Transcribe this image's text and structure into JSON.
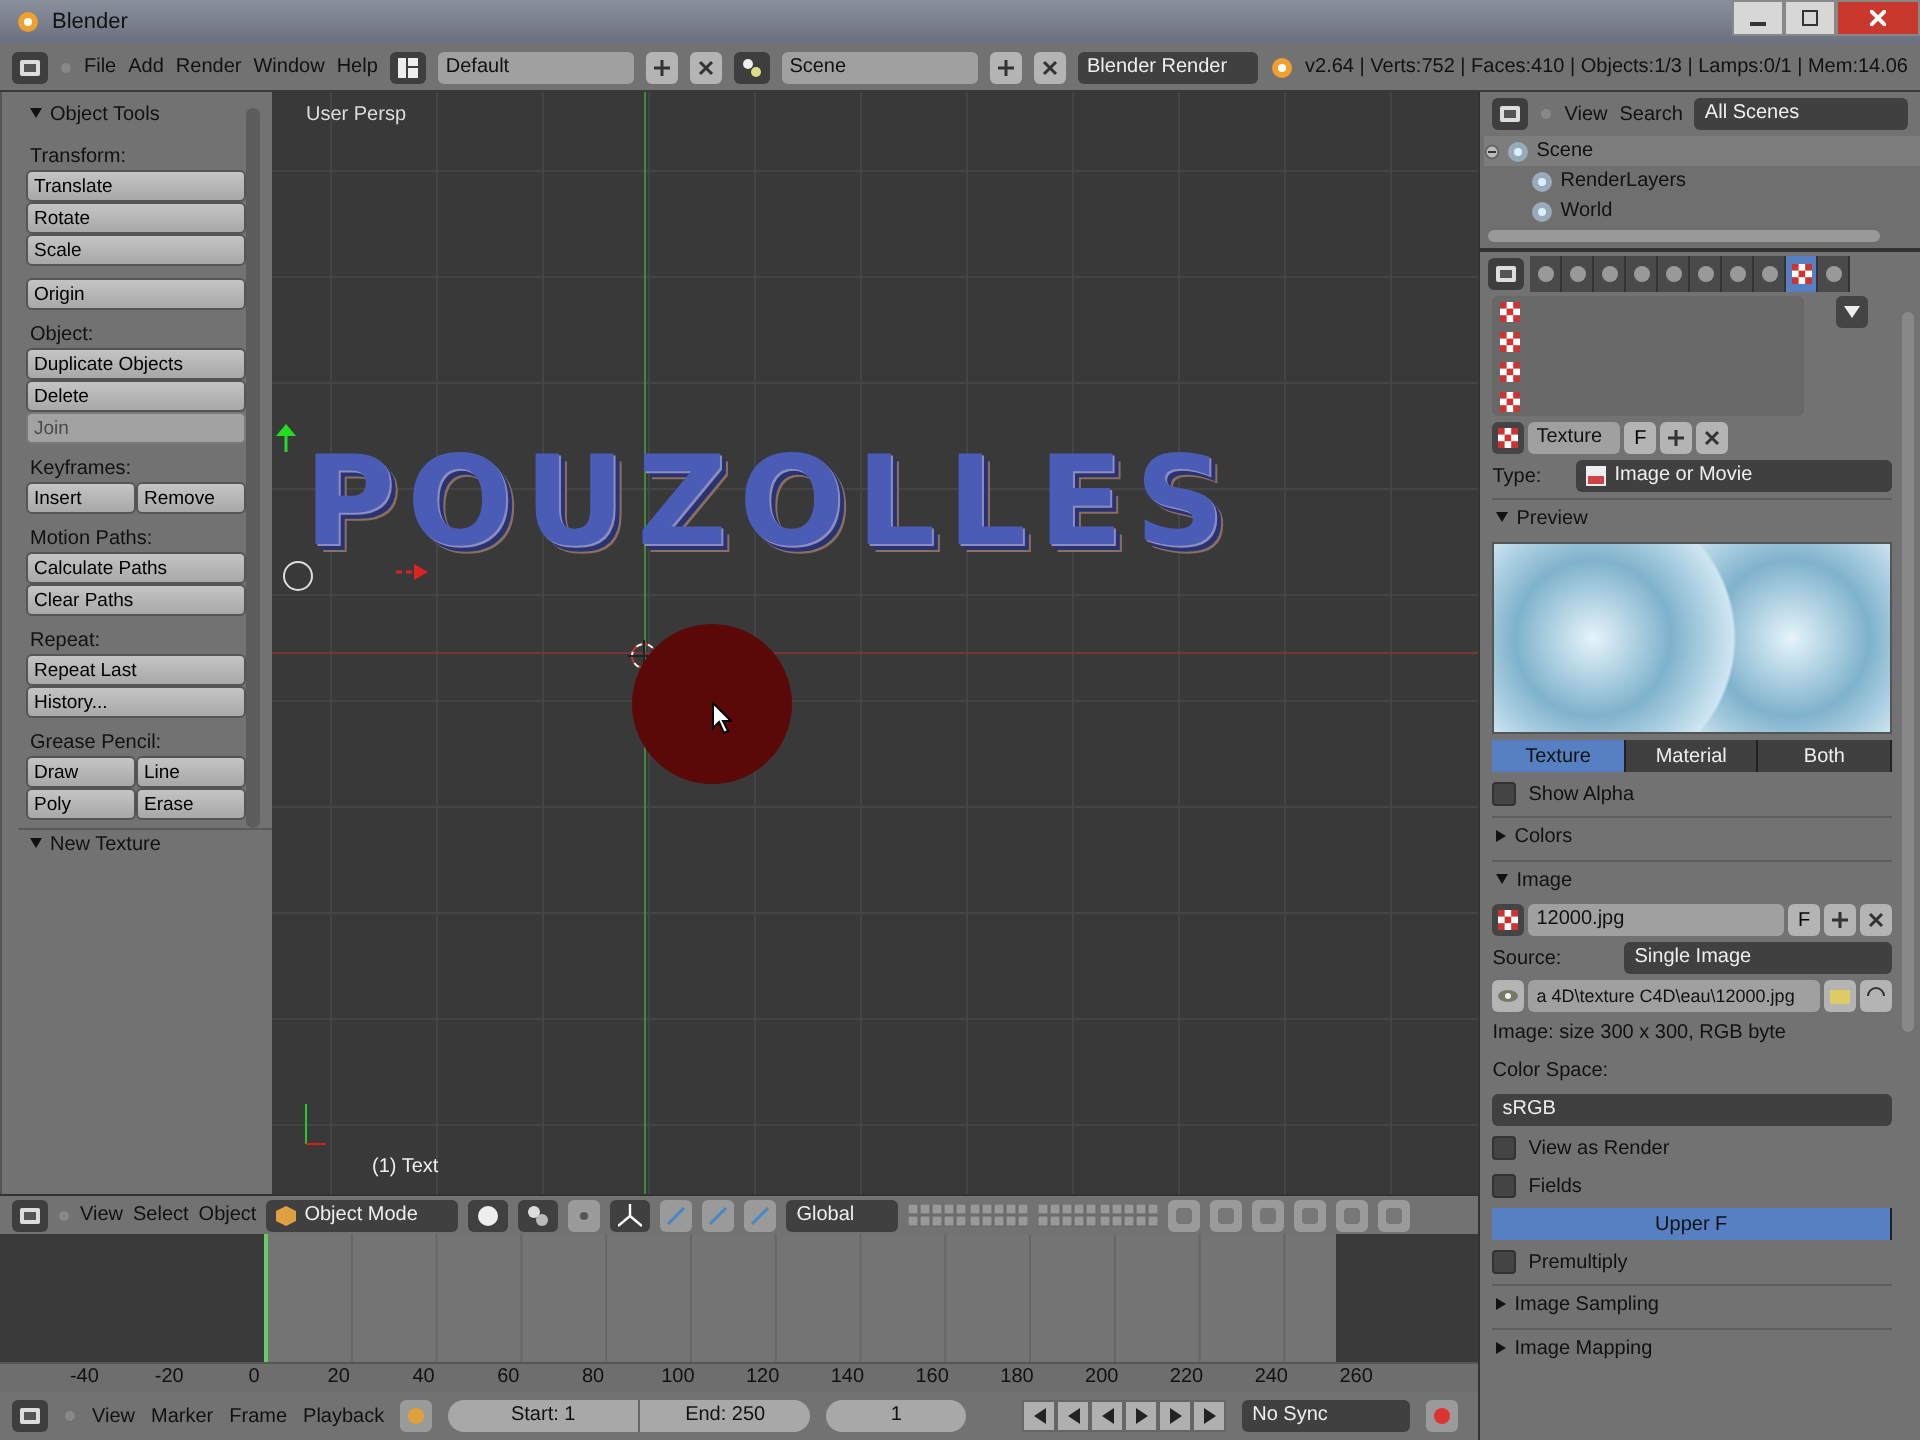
{
  "title_bar": {
    "title": "Blender"
  },
  "info_header": {
    "menus": [
      "File",
      "Add",
      "Render",
      "Window",
      "Help"
    ],
    "screen_layout": "Default",
    "scene": "Scene",
    "render_engine": "Blender Render",
    "stats": "v2.64 | Verts:752 | Faces:410 | Objects:1/3 | Lamps:0/1 | Mem:14.06"
  },
  "tool_shelf": {
    "title": "Object Tools",
    "sections": [
      {
        "label": "Transform:",
        "rows": [
          [
            {
              "label": "Translate",
              "disabled": false
            }
          ],
          [
            {
              "label": "Rotate",
              "disabled": false
            }
          ],
          [
            {
              "label": "Scale",
              "disabled": false
            }
          ]
        ]
      },
      {
        "rows": [
          [
            {
              "label": "Origin",
              "disabled": false
            }
          ]
        ]
      },
      {
        "label": "Object:",
        "rows": [
          [
            {
              "label": "Duplicate Objects",
              "disabled": false
            }
          ],
          [
            {
              "label": "Delete",
              "disabled": false
            }
          ],
          [
            {
              "label": "Join",
              "disabled": true
            }
          ]
        ]
      },
      {
        "label": "Keyframes:",
        "rows": [
          [
            {
              "label": "Insert",
              "disabled": false
            },
            {
              "label": "Remove",
              "disabled": false
            }
          ]
        ]
      },
      {
        "label": "Motion Paths:",
        "rows": [
          [
            {
              "label": "Calculate Paths",
              "disabled": false
            }
          ],
          [
            {
              "label": "Clear Paths",
              "disabled": false
            }
          ]
        ]
      },
      {
        "label": "Repeat:",
        "rows": [
          [
            {
              "label": "Repeat Last",
              "disabled": false
            }
          ],
          [
            {
              "label": "History...",
              "disabled": false
            }
          ]
        ]
      },
      {
        "label": "Grease Pencil:",
        "rows": [
          [
            {
              "label": "Draw",
              "disabled": false
            },
            {
              "label": "Line",
              "disabled": false
            }
          ],
          [
            {
              "label": "Poly",
              "disabled": false
            },
            {
              "label": "Erase",
              "disabled": false
            }
          ]
        ]
      }
    ],
    "footer_panel": "New Texture"
  },
  "viewport": {
    "view_name": "User Persp",
    "object_info": "(1) Text",
    "text_object": "POUZOLLES"
  },
  "view3d_header": {
    "menus": [
      "View",
      "Select",
      "Object"
    ],
    "mode": "Object Mode",
    "transform_orientation": "Global"
  },
  "timeline": {
    "ruler_labels": [
      "-40",
      "-20",
      "0",
      "20",
      "40",
      "60",
      "80",
      "100",
      "120",
      "140",
      "160",
      "180",
      "200",
      "220",
      "240",
      "260"
    ]
  },
  "timeline_header": {
    "menus": [
      "View",
      "Marker",
      "Frame",
      "Playback"
    ],
    "start": "Start: 1",
    "end": "End: 250",
    "current_frame": "1",
    "sync": "No Sync"
  },
  "outliner": {
    "menus": [
      "View",
      "Search"
    ],
    "display_mode": "All Scenes",
    "tree": [
      {
        "label": "Scene",
        "selected": true,
        "expanded": true,
        "children": [
          {
            "label": "RenderLayers",
            "selected": false
          },
          {
            "label": "World",
            "selected": false
          }
        ]
      }
    ]
  },
  "properties": {
    "tabs": [
      {
        "selected": false
      },
      {
        "selected": false
      },
      {
        "selected": false
      },
      {
        "selected": false
      },
      {
        "selected": false
      },
      {
        "selected": false
      },
      {
        "selected": false
      },
      {
        "selected": false
      },
      {
        "selected": true
      },
      {
        "selected": false
      }
    ],
    "texture_slots": [
      {
        "selected": false
      },
      {
        "selected": false
      },
      {
        "selected": false
      },
      {
        "selected": false
      }
    ],
    "datablock": {
      "name": "Texture",
      "fake_user": "F"
    },
    "type": {
      "label": "Type:",
      "value": "Image or Movie"
    },
    "panels": [
      {
        "title": "Preview",
        "expanded": true,
        "items": [
          {
            "kind": "preview"
          },
          {
            "kind": "segmented",
            "options": [
              {
                "label": "Texture",
                "selected": true
              },
              {
                "label": "Material",
                "selected": false
              },
              {
                "label": "Both",
                "selected": false
              }
            ]
          },
          {
            "kind": "checkbox",
            "label": "Show Alpha",
            "checked": false
          }
        ]
      },
      {
        "title": "Colors",
        "expanded": false
      },
      {
        "title": "Image",
        "expanded": true,
        "items": [
          {
            "kind": "datablock",
            "value": "12000.jpg",
            "fake_user": "F"
          },
          {
            "kind": "dropdown",
            "label": "Source:",
            "value": "Single Image"
          },
          {
            "kind": "path",
            "value": "a 4D\\texture C4D\\eau\\12000.jpg"
          },
          {
            "kind": "text",
            "text": "Image: size 300 x 300, RGB byte"
          },
          {
            "kind": "text",
            "text": "Color Space:"
          },
          {
            "kind": "dropdown",
            "value": "sRGB"
          },
          {
            "kind": "checkbox",
            "label": "View as Render",
            "checked": false
          },
          {
            "kind": "checkbox",
            "label": "Fields",
            "checked": false
          },
          {
            "kind": "segmented",
            "options": [
              {
                "label": "Upper F",
                "selected": true
              }
            ]
          },
          {
            "kind": "checkbox",
            "label": "Premultiply",
            "checked": false
          }
        ]
      },
      {
        "title": "Image Sampling",
        "expanded": false
      },
      {
        "title": "Image Mapping",
        "expanded": false
      }
    ]
  }
}
